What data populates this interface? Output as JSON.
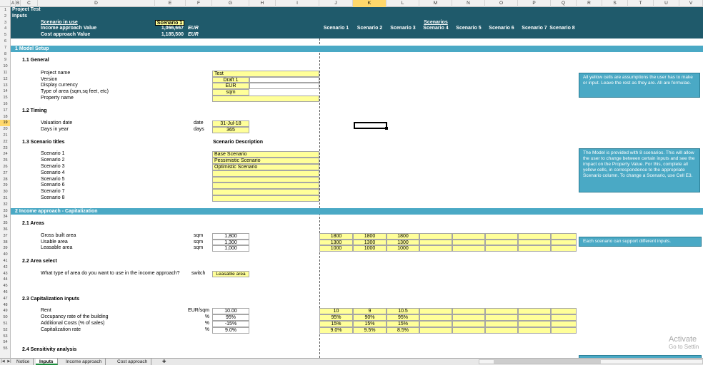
{
  "column_headers": [
    "A",
    "B",
    "C",
    "D",
    "E",
    "F",
    "G",
    "H",
    "I",
    "J",
    "K",
    "L",
    "M",
    "N",
    "O",
    "P",
    "Q",
    "R",
    "S",
    "T",
    "U",
    "V"
  ],
  "selected_column": "K",
  "row_numbers": [
    "1",
    "2",
    "3",
    "4",
    "5",
    "6",
    "7",
    "8",
    "9",
    "10",
    "11",
    "12",
    "13",
    "14",
    "15",
    "16",
    "17",
    "18",
    "19",
    "20",
    "21",
    "22",
    "23",
    "24",
    "25",
    "26",
    "27",
    "28",
    "29",
    "30",
    "31",
    "32",
    "33",
    "34",
    "35",
    "36",
    "37",
    "38",
    "39",
    "40",
    "41",
    "42",
    "43",
    "44",
    "45",
    "46",
    "47",
    "48",
    "49",
    "50",
    "51",
    "52",
    "53",
    "54",
    "55"
  ],
  "selected_row": "19",
  "header": {
    "title": "Project Test",
    "subtitle": "Inputs",
    "scenario_in_use_label": "Scenario in use",
    "scenario_in_use_value": "Scenario 1",
    "income_label": "Income approach Value",
    "income_value": "1,066,667",
    "income_unit": "EUR",
    "cost_label": "Cost approach Value",
    "cost_value": "1,185,500",
    "cost_unit": "EUR",
    "scenarios_label": "Scenarios",
    "scenario_columns": [
      "Scenario 1",
      "Scenario 2",
      "Scenario 3",
      "Scenario 4",
      "Scenario 5",
      "Scenario 6",
      "Scenario 7",
      "Scenario 8"
    ]
  },
  "section1": {
    "title": "1  Model Setup",
    "general": {
      "title": "1.1  General",
      "rows": [
        {
          "label": "Project name",
          "value": "Test"
        },
        {
          "label": "Version",
          "value": "Draft 1"
        },
        {
          "label": "Display currency",
          "value": "EUR"
        },
        {
          "label": "Type of area (sqm,sq feet, etc)",
          "value": "sqm"
        },
        {
          "label": "Property name",
          "value": ""
        }
      ]
    },
    "timing": {
      "title": "1.2  Timing",
      "rows": [
        {
          "label": "Valuation date",
          "unit": "date",
          "value": "31-Jul-18"
        },
        {
          "label": "Days in year",
          "unit": "days",
          "value": "365"
        }
      ]
    },
    "titles": {
      "title": "1.3  Scenario titles",
      "desc_header": "Scenario Description",
      "rows": [
        {
          "label": "Scenario 1",
          "value": "Base Scenario"
        },
        {
          "label": "Scenario 2",
          "value": "Pessimistic Scenario"
        },
        {
          "label": "Scenario 3",
          "value": "Optimistic Scenario"
        },
        {
          "label": "Scenario 4",
          "value": ""
        },
        {
          "label": "Scenario 5",
          "value": ""
        },
        {
          "label": "Scenario 6",
          "value": ""
        },
        {
          "label": "Scenario 7",
          "value": ""
        },
        {
          "label": "Scenario 8",
          "value": ""
        }
      ]
    }
  },
  "section2": {
    "title": "2  Income approach - Capitalization",
    "areas": {
      "title": "2.1  Areas",
      "rows": [
        {
          "label": "Gross built area",
          "unit": "sqm",
          "value": "1,800",
          "scenarios": [
            "1800",
            "1800",
            "1800",
            "",
            "",
            "",
            "",
            ""
          ]
        },
        {
          "label": "Usable area",
          "unit": "sqm",
          "value": "1,300",
          "scenarios": [
            "1300",
            "1300",
            "1300",
            "",
            "",
            "",
            "",
            ""
          ]
        },
        {
          "label": "Leasable area",
          "unit": "sqm",
          "value": "1,000",
          "scenarios": [
            "1000",
            "1000",
            "1000",
            "",
            "",
            "",
            "",
            ""
          ]
        }
      ]
    },
    "area_select": {
      "title": "2.2  Area select",
      "question": "What type of area do you want to use in the income approach?",
      "unit": "switch",
      "value": "Leasable area"
    },
    "cap_inputs": {
      "title": "2.3  Capitalization inputs",
      "rows": [
        {
          "label": "Rent",
          "unit": "EUR/sqm",
          "value": "10.00",
          "scenarios": [
            "10",
            "9",
            "10.5",
            "",
            "",
            "",
            "",
            ""
          ]
        },
        {
          "label": "Occupancy rate of the building",
          "unit": "%",
          "value": "95%",
          "scenarios": [
            "95%",
            "90%",
            "95%",
            "",
            "",
            "",
            "",
            ""
          ]
        },
        {
          "label": "Additional Costs (% of sales)",
          "unit": "%",
          "value": "-15%",
          "scenarios": [
            "15%",
            "15%",
            "15%",
            "",
            "",
            "",
            "",
            ""
          ]
        },
        {
          "label": "Capitalization rate",
          "unit": "%",
          "value": "9.0%",
          "scenarios": [
            "9.0%",
            "9.5%",
            "8.5%",
            "",
            "",
            "",
            "",
            ""
          ]
        }
      ]
    },
    "sensitivity": {
      "title": "2.4  Sensitivity analysis"
    }
  },
  "notes": [
    "All yellow cells are assumptions the user has to make or input. Leave the rest as they are. All are formulae.",
    "The Model is provided with 8 scenarios. This will allow the user to change between certain inputs and see the impact on the Property Value. For this, complete all yellow cells, in correspondence to the appropriate Scenario column. To change a Scenario, use Cell E3.",
    "Each scenario can support different inputs."
  ],
  "sheet_tabs": [
    {
      "label": "Notice",
      "active": false
    },
    {
      "label": "Inputs",
      "active": true
    },
    {
      "label": "Income approach",
      "active": false
    },
    {
      "label": "Cost approach",
      "active": false
    }
  ],
  "activate_windows": {
    "line1": "Activate",
    "line2": "Go to Settin"
  },
  "colors": {
    "header_teal": "#1f5a6b",
    "section_band": "#4aa9c5",
    "input_yellow": "#ffff99",
    "selected_header": "#ffd86b"
  }
}
